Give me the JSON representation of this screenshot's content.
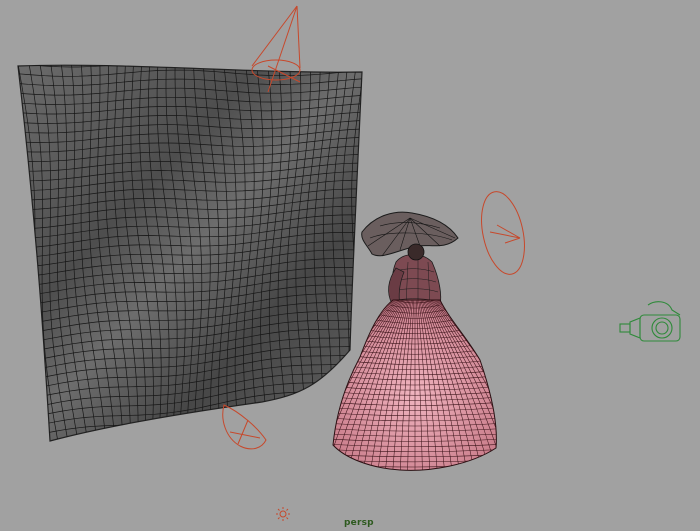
{
  "viewport": {
    "camera_label": "persp",
    "background_color": "#a1a1a1"
  },
  "objects": [
    {
      "name": "cloth-mesh",
      "kind": "polygon cloth (wireframe on shaded)",
      "color": "#5a5a5a",
      "wire_color": "#1a1a1a"
    },
    {
      "name": "victorian-dress-figure",
      "kind": "character with parasol (wireframe on shaded)",
      "color": "#e7a0ad",
      "wire_color": "#2a0f12"
    },
    {
      "name": "spot-light-top",
      "kind": "spot light",
      "color": "#c7482b"
    },
    {
      "name": "spot-light-right",
      "kind": "spot light",
      "color": "#c7482b"
    },
    {
      "name": "spot-light-bottom",
      "kind": "spot light",
      "color": "#c7482b"
    },
    {
      "name": "camera",
      "kind": "camera",
      "color": "#2f8a3a"
    },
    {
      "name": "directional-light",
      "kind": "light icon",
      "color": "#c7482b"
    }
  ]
}
